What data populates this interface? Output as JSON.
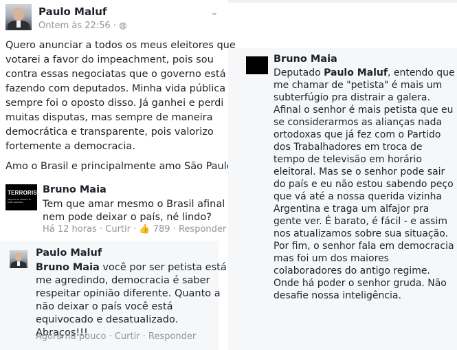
{
  "post": {
    "author": "Paulo Maluf",
    "time": "Ontem às 22:56",
    "sep": "·",
    "privacy_icon": "globe-icon",
    "lines": [
      "Quero anunciar a todos os meus eleitores que",
      "votarei a favor do impeachment, pois sou",
      "contra essas negociatas que o governo está",
      "fazendo com deputados. Minha vida pública",
      "sempre foi o oposto disso. Já ganhei e perdi",
      "muitas disputas, mas sempre de maneira",
      "democrática e transparente, pois valorizo",
      "fortemente a democracia."
    ],
    "closing": "Amo o Brasil e principalmente amo São Paulo."
  },
  "comment1": {
    "author": "Bruno Maia",
    "avatar_word": "TERRORISTA",
    "avatar_small": "(Segundo PL 2016/15, do Poder Executivo)",
    "lines": [
      "Tem que amar mesmo o Brasil afinal",
      "nem pode deixar o país, né lindo?"
    ],
    "time": "Há 12 horas",
    "sep": "·",
    "action_reply_short": "Curtir",
    "like_icon": "thumbs-up-icon",
    "likes": "789",
    "action_reply": "Responder"
  },
  "reply": {
    "author": "Paulo Maluf",
    "mention": "Bruno Maia",
    "first_rest": " você por ser petista está",
    "lines": [
      "me agredindo, democracia é saber",
      "respeitar opinião diferente. Quanto a",
      "não deixar o país você está",
      "equivocado e desatualizado.",
      "Abraços!!!"
    ],
    "time": "Agora há pouco",
    "sep": "·",
    "like": "Curtir",
    "respond": "Responder"
  },
  "right": {
    "author": "Bruno Maia",
    "first_pre": "Deputado ",
    "first_bold": "Paulo Maluf",
    "first_post": ", entendo que",
    "lines": [
      "me chamar de \"petista\" é mais um",
      "subterfúgio pra distrair a galera.",
      "Afinal o senhor é mais petista que eu",
      "se considerarmos as alianças nada",
      "ortodoxas que já fez com o Partido",
      "dos Trabalhadores em troca de",
      "tempo de televisão em horário",
      "eleitoral. Mas se o senhor pode sair",
      "do país e eu não estou sabendo peço",
      "que vá até a nossa querida vizinha",
      "Argentina e traga um alfajor pra",
      "gente ver. É barato, é fácil - e assim",
      "nos atualizamos sobre sua situação.",
      "Por fim, o senhor fala em democracia",
      "mas foi um dos maiores",
      "colaboradores do antigo regime.",
      "Onde há poder o senhor gruda. Não",
      "desafie nossa inteligência."
    ]
  },
  "icons": {
    "menu": "chevron-down-icon"
  }
}
